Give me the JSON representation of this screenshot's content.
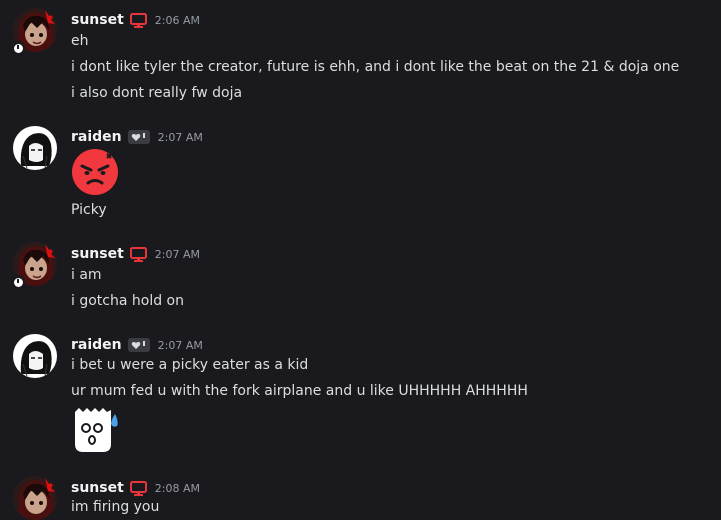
{
  "messages": [
    {
      "author": "sunset",
      "badge_icon": "monitor-icon",
      "time": "2:06 AM",
      "lines": [
        "eh",
        "i dont like tyler the creator, future is ehh, and i dont like the beat on the 21 & doja one",
        "i also dont really fw doja"
      ]
    },
    {
      "author": "raiden",
      "badge_icon": "heart-badge-icon",
      "time": "2:07 AM",
      "emoji": "angry-face-emoji",
      "lines": [
        "Picky"
      ]
    },
    {
      "author": "sunset",
      "badge_icon": "monitor-icon",
      "time": "2:07 AM",
      "lines": [
        "i am",
        "i gotcha hold on"
      ]
    },
    {
      "author": "raiden",
      "badge_icon": "heart-badge-icon",
      "time": "2:07 AM",
      "lines": [
        "i bet u were a picky eater as a kid",
        "ur mum fed u with the fork airplane and u like UHHHHH AHHHHH"
      ],
      "emoji": "nervous-ghost-emoji"
    },
    {
      "author": "sunset",
      "badge_icon": "monitor-icon",
      "time": "2:08 AM",
      "lines": [
        "im firing you"
      ]
    }
  ],
  "colors": {
    "background": "#1a1a1e",
    "username": "#f2f3f5",
    "text": "#dbdee1",
    "timestamp": "#949ba4",
    "monitor_badge": "#e8353b",
    "angry_emoji": "#f0383e"
  }
}
